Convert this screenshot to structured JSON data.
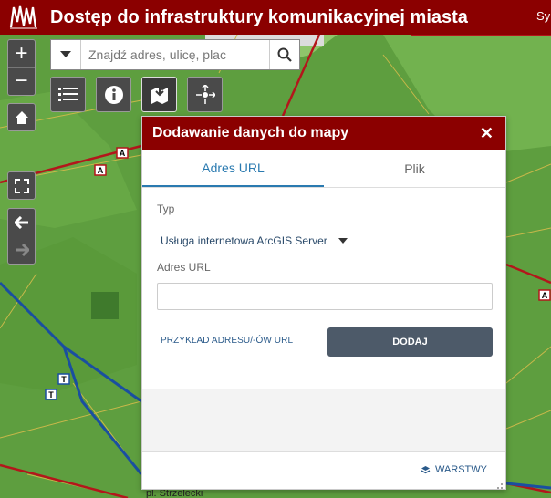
{
  "header": {
    "title": "Dostęp do infrastruktury komunikacyjnej miasta",
    "right_link": "Sy"
  },
  "search": {
    "placeholder": "Znajdź adres, ulicę, plac"
  },
  "map_controls": {
    "zoom_in": "+",
    "zoom_out": "−"
  },
  "map_labels": {
    "road_marker_a": "A",
    "tram_marker_t": "T",
    "street_name": "pl. Strzelecki"
  },
  "panel": {
    "title": "Dodawanie danych do mapy",
    "close": "✕",
    "tabs": [
      {
        "label": "Adres URL",
        "active": true
      },
      {
        "label": "Plik",
        "active": false
      }
    ],
    "type_label": "Typ",
    "type_value": "Usługa internetowa ArcGIS Server",
    "url_label": "Adres URL",
    "url_value": "",
    "example_link": "PRZYKŁAD ADRESU/-ÓW URL",
    "add_button": "DODAJ",
    "layers_link": "WARSTWY"
  },
  "colors": {
    "header_bg": "#8b0000",
    "accent": "#2a7ab0",
    "button_dark": "#4d5a69",
    "map_green": "#5a9b3c"
  }
}
